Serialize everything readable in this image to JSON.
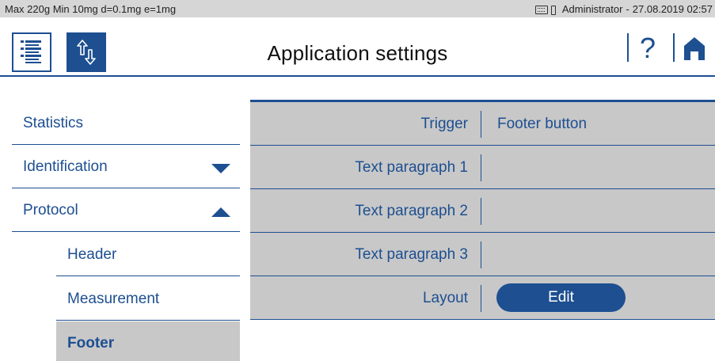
{
  "statusbar": {
    "scale_info": "Max 220g  Min 10mg  d=0.1mg  e=1mg",
    "user": "Administrator",
    "datetime_separator": "-",
    "datetime": "27.08.2019 02:57"
  },
  "header": {
    "title": "Application settings",
    "help_label": "?"
  },
  "nav": {
    "items": [
      {
        "label": "Statistics"
      },
      {
        "label": "Identification",
        "state": "collapsed"
      },
      {
        "label": "Protocol",
        "state": "expanded"
      }
    ],
    "sub_items": [
      {
        "label": "Header"
      },
      {
        "label": "Measurement"
      },
      {
        "label": "Footer",
        "active": true
      }
    ]
  },
  "settings": {
    "rows": [
      {
        "key": "Trigger",
        "value": "Footer button"
      },
      {
        "key": "Text paragraph 1",
        "value": ""
      },
      {
        "key": "Text paragraph 2",
        "value": ""
      },
      {
        "key": "Text paragraph 3",
        "value": ""
      },
      {
        "key": "Layout",
        "button": "Edit"
      }
    ]
  },
  "colors": {
    "accent": "#1d4f91",
    "status_bar": "#d6d6d6",
    "panel": "#c8c8c8"
  }
}
